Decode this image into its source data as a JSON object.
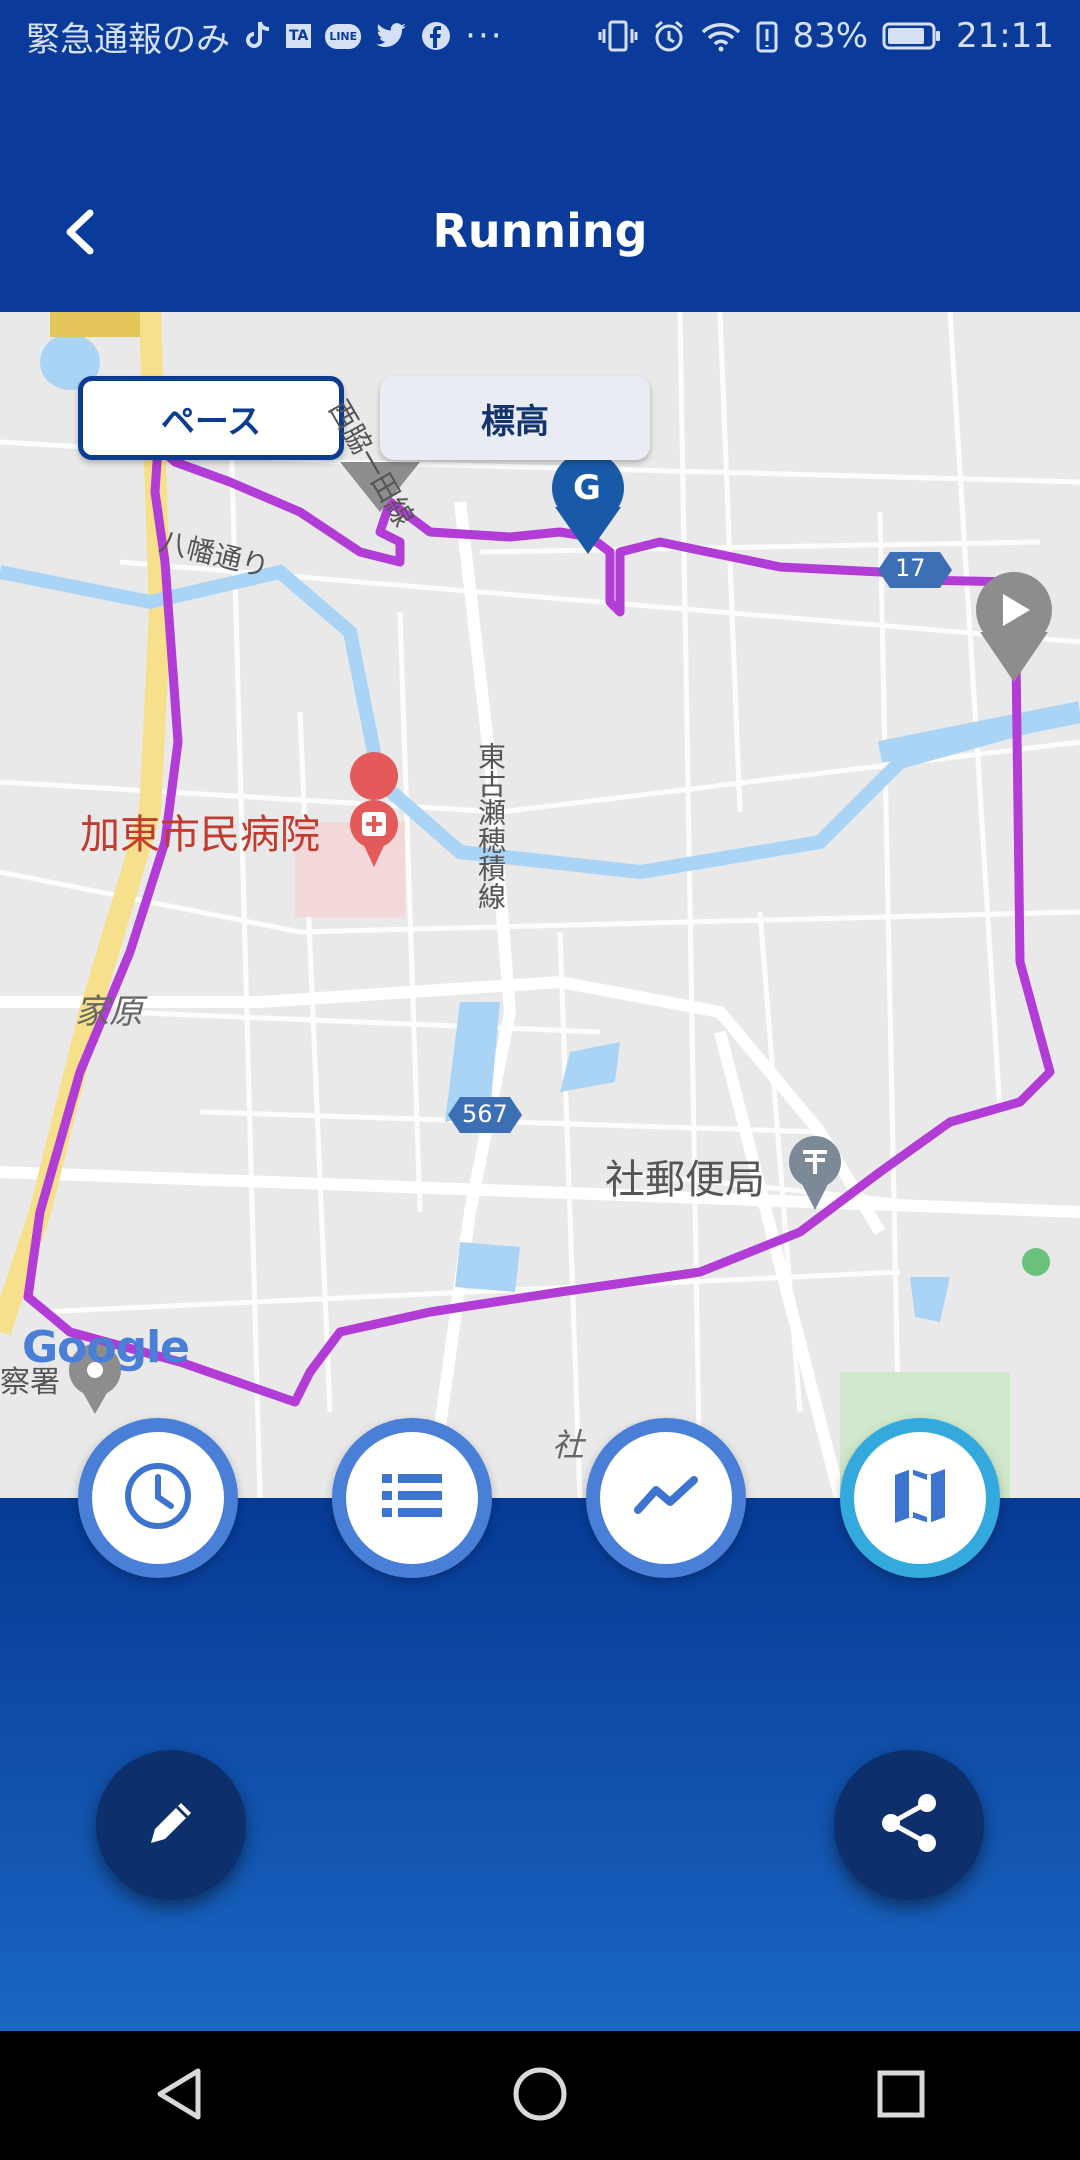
{
  "status_bar": {
    "carrier_text": "緊急通報のみ",
    "notif_ta": "TA",
    "notif_line": "LINE",
    "battery": "83%",
    "time": "21:11",
    "left_icons": [
      "tiktok-icon",
      "ta-icon",
      "line-icon",
      "twitter-icon",
      "facebook-icon",
      "more-icon"
    ],
    "right_icons": [
      "vibrate-icon",
      "alarm-icon",
      "wifi-icon",
      "battery-alert-icon",
      "battery-icon"
    ]
  },
  "header": {
    "title": "Running",
    "back_icon": "chevron-left-icon"
  },
  "map": {
    "toggle_pace": "ペース",
    "toggle_elevation": "標高",
    "labels": {
      "hospital": "加東市民病院",
      "area_kahara": "家原",
      "post_office": "社郵便局",
      "road_yawata": "八幡通り",
      "road_nishiwaki": "西脇一田線",
      "road_higashikose": "東古瀬穂積線",
      "route_17": "17",
      "route_567": "567",
      "bottom_sha": "社",
      "google": "Google",
      "police_partial": "察署",
      "goal_marker": "G"
    },
    "route_color": "#b23cd6"
  },
  "tabs": [
    {
      "name": "clock-icon",
      "active": false
    },
    {
      "name": "list-icon",
      "active": false
    },
    {
      "name": "chart-icon",
      "active": false
    },
    {
      "name": "map-icon",
      "active": true
    }
  ],
  "actions": {
    "edit_icon": "pencil-icon",
    "share_icon": "share-icon"
  },
  "nav": [
    "back-triangle-icon",
    "home-circle-icon",
    "recents-square-icon"
  ]
}
